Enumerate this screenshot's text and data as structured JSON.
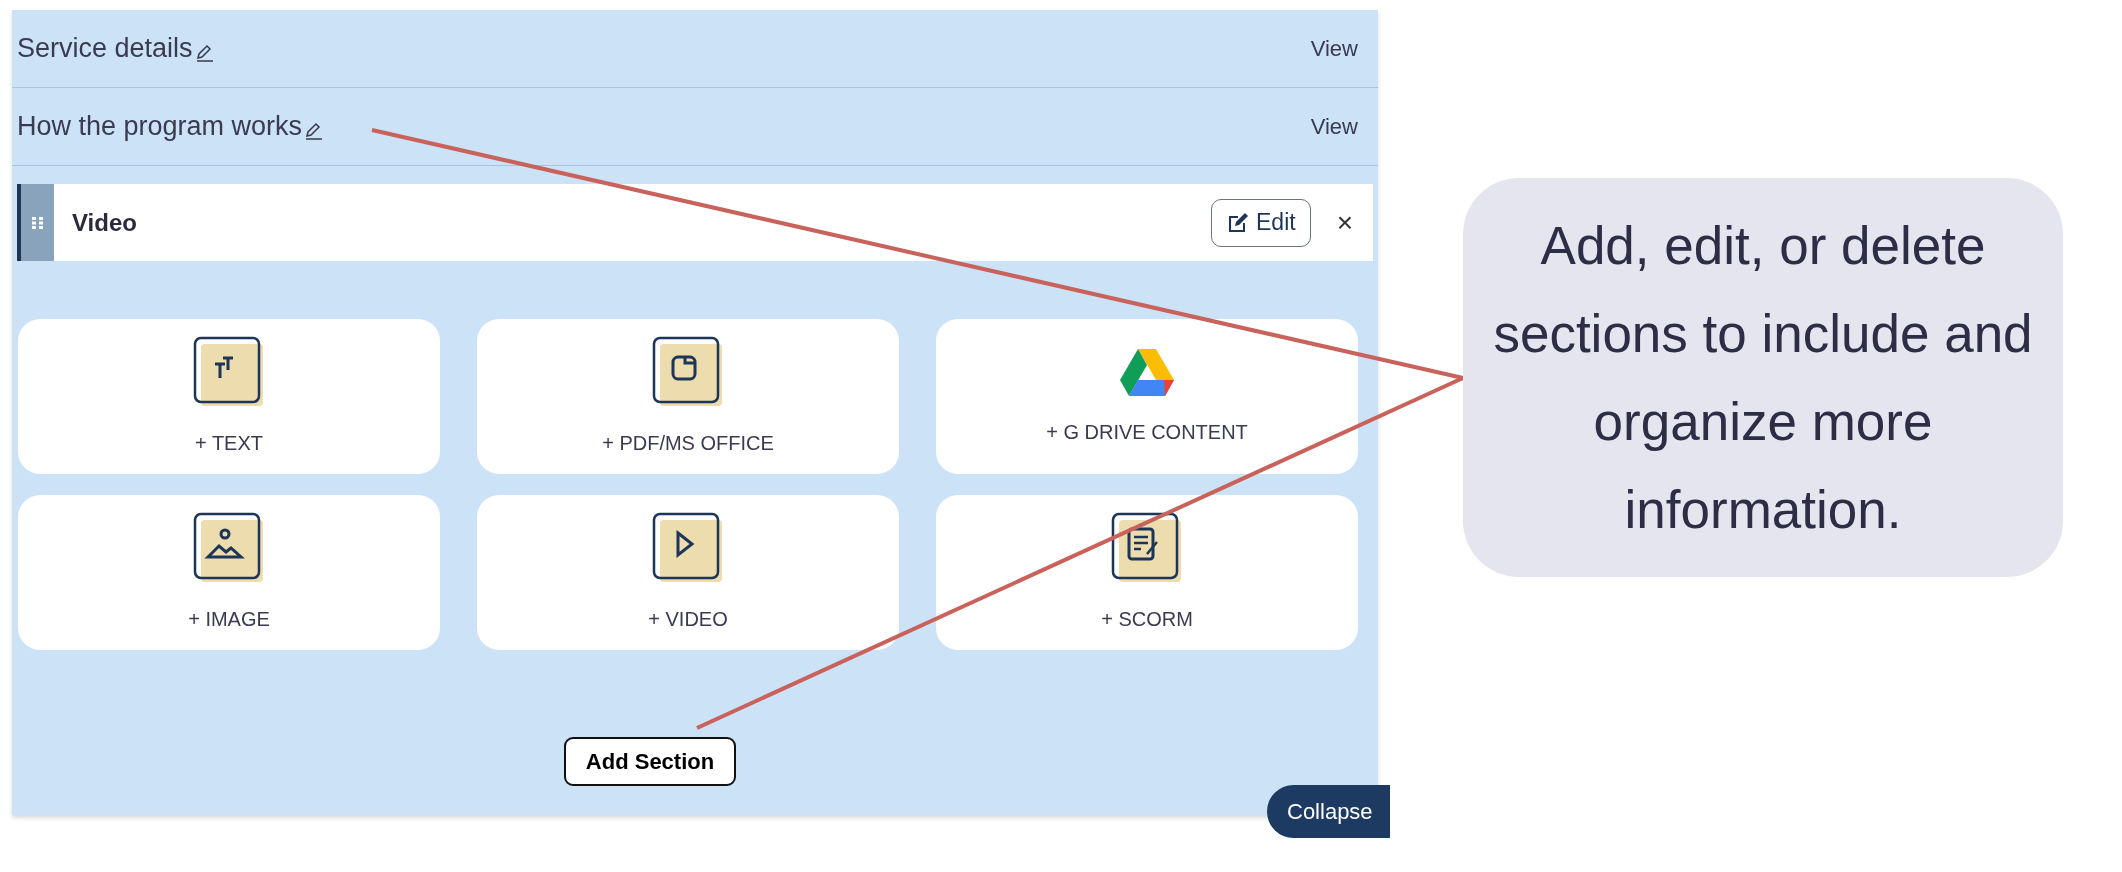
{
  "sections": [
    {
      "title": "Service details",
      "action": "View"
    },
    {
      "title": "How the program works",
      "action": "View"
    }
  ],
  "content_block": {
    "title": "Video",
    "edit_label": "Edit",
    "close": "×"
  },
  "content_options": [
    {
      "kind": "text",
      "label": "+ TEXT"
    },
    {
      "kind": "document",
      "label": "+ PDF/MS OFFICE"
    },
    {
      "kind": "drive",
      "label": "+ G DRIVE CONTENT"
    },
    {
      "kind": "image",
      "label": "+ IMAGE"
    },
    {
      "kind": "video",
      "label": "+ VIDEO"
    },
    {
      "kind": "scorm",
      "label": "+ SCORM"
    }
  ],
  "add_section": "Add Section",
  "collapse": "Collapse",
  "callout": {
    "text": "Add, edit, or delete sections to include and organize more information."
  }
}
